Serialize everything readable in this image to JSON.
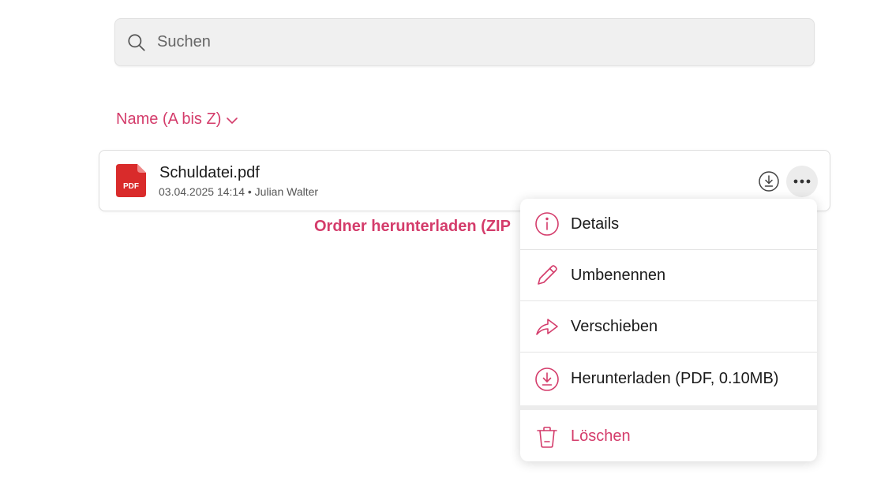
{
  "search": {
    "placeholder": "Suchen",
    "icon": "search-icon"
  },
  "sort": {
    "label": "Name (A bis Z)",
    "icon": "chevron-down-icon"
  },
  "file": {
    "icon": "pdf-file-icon",
    "icon_text": "PDF",
    "name": "Schuldatei.pdf",
    "meta": "03.04.2025 14:14 • Julian Walter"
  },
  "zip_link": "Ordner herunterladen (ZIP",
  "menu": {
    "items": [
      {
        "label": "Details",
        "icon": "info-icon"
      },
      {
        "label": "Umbenennen",
        "icon": "pencil-icon"
      },
      {
        "label": "Verschieben",
        "icon": "move-arrow-icon"
      },
      {
        "label": "Herunterladen (PDF, 0.10MB)",
        "icon": "download-icon"
      }
    ],
    "danger_item": {
      "label": "Löschen",
      "icon": "trash-icon"
    }
  },
  "colors": {
    "accent": "#d43c6b",
    "pdf_red": "#d92b2b",
    "search_bg": "#f0f0f0"
  }
}
